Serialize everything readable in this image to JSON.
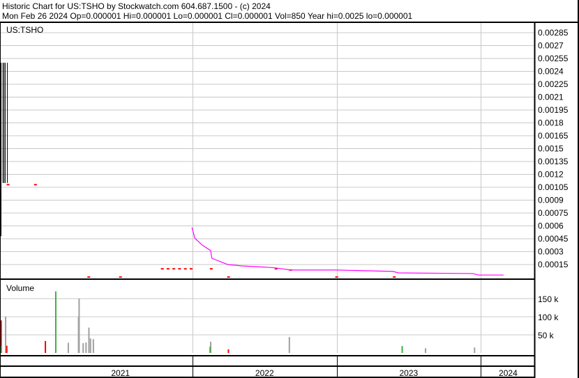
{
  "header": {
    "title": "Historic Chart for US:TSHO by Stockwatch.com 604.687.1500 - (c) 2024",
    "quote": "Mon Feb 26 2024   Op=0.000001   Hi=0.000001   Lo=0.000001   Cl=0.000001   Vol=850   Year hi=0.0025   lo=0.000001"
  },
  "colors": {
    "line": "#ff00ff",
    "down": "#ff0000",
    "up": "#3cb043",
    "neutral": "#a0a0a0",
    "grid": "#c8c8c8"
  },
  "chart_data": {
    "type": "line",
    "symbol": "US:TSHO",
    "price_ticks": [
      "0.00285",
      "0.0027",
      "0.00255",
      "0.0024",
      "0.00225",
      "0.0021",
      "0.00195",
      "0.0018",
      "0.00165",
      "0.0015",
      "0.00135",
      "0.0012",
      "0.00105",
      "0.0009",
      "0.00075",
      "0.0006",
      "0.00045",
      "0.0003",
      "0.00015"
    ],
    "price_range": [
      0,
      0.00292
    ],
    "x_range": [
      2020.664,
      2024.372
    ],
    "year_labels": [
      {
        "label": "2021",
        "center": 2021.5
      },
      {
        "label": "2022",
        "center": 2022.5
      },
      {
        "label": "2023",
        "center": 2023.5
      },
      {
        "label": "2024",
        "center": 2024.19
      }
    ],
    "year_bounds": [
      2022,
      2023,
      2024
    ],
    "moving_average": [
      [
        2021.996,
        0.00058
      ],
      [
        2022.016,
        0.000458
      ],
      [
        2022.067,
        0.000377
      ],
      [
        2022.126,
        0.000312
      ],
      [
        2022.134,
        0.000223
      ],
      [
        2022.245,
        0.00015
      ],
      [
        2022.344,
        0.000134
      ],
      [
        2022.522,
        0.000118
      ],
      [
        2022.581,
        0.00011
      ],
      [
        2022.68,
        8.6e-05
      ],
      [
        2022.996,
        8.6e-05
      ],
      [
        2023.391,
        7e-05
      ],
      [
        2023.43,
        5.3e-05
      ],
      [
        2023.945,
        4.5e-05
      ],
      [
        2023.984,
        2.8e-05
      ],
      [
        2024.158,
        2.8e-05
      ]
    ],
    "price_bars": [
      [
        2020.684,
        0.0025,
        0.0011
      ],
      [
        2020.692,
        0.0025,
        0.0011
      ],
      [
        2020.7,
        0.0025,
        0.0011
      ],
      [
        2020.715,
        0.0025,
        0.0011
      ]
    ],
    "red_points": [
      [
        2020.72,
        0.00108
      ],
      [
        2020.91,
        0.00108
      ],
      [
        2021.79,
        0.0001
      ],
      [
        2021.83,
        0.0001
      ],
      [
        2021.87,
        0.0001
      ],
      [
        2021.91,
        0.0001
      ],
      [
        2021.95,
        0.0001
      ],
      [
        2021.99,
        0.0001
      ],
      [
        2022.13,
        0.0001
      ],
      [
        2022.58,
        0.0001
      ],
      [
        2022.68,
        8.6e-05
      ],
      [
        2021.28,
        5e-06
      ],
      [
        2021.5,
        5e-06
      ],
      [
        2022.25,
        5e-06
      ],
      [
        2023.0,
        5e-06
      ],
      [
        2023.4,
        5e-06
      ]
    ],
    "volume_label": "Volume",
    "volume_ticks": [
      {
        "label": "150 k",
        "value": 150000
      },
      {
        "label": "100 k",
        "value": 100000
      },
      {
        "label": "50 k",
        "value": 50000
      }
    ],
    "volume_max": 190000,
    "volume": [
      [
        2020.672,
        90000,
        "down"
      ],
      [
        2020.668,
        20000,
        "up"
      ],
      [
        2020.703,
        100000,
        "neutral"
      ],
      [
        2020.711,
        20000,
        "down"
      ],
      [
        2020.979,
        33000,
        "down"
      ],
      [
        2021.051,
        170000,
        "up"
      ],
      [
        2021.138,
        28000,
        "neutral"
      ],
      [
        2021.209,
        100000,
        "neutral"
      ],
      [
        2021.213,
        150000,
        "neutral"
      ],
      [
        2021.241,
        27000,
        "neutral"
      ],
      [
        2021.261,
        29000,
        "neutral"
      ],
      [
        2021.281,
        70000,
        "neutral"
      ],
      [
        2021.292,
        40000,
        "neutral"
      ],
      [
        2021.312,
        38000,
        "neutral"
      ],
      [
        2022.126,
        31000,
        "neutral"
      ],
      [
        2022.122,
        17000,
        "up"
      ],
      [
        2022.249,
        10000,
        "down"
      ],
      [
        2022.672,
        44000,
        "neutral"
      ],
      [
        2023.455,
        19000,
        "up"
      ],
      [
        2023.617,
        13000,
        "neutral"
      ],
      [
        2023.957,
        15000,
        "neutral"
      ]
    ]
  }
}
